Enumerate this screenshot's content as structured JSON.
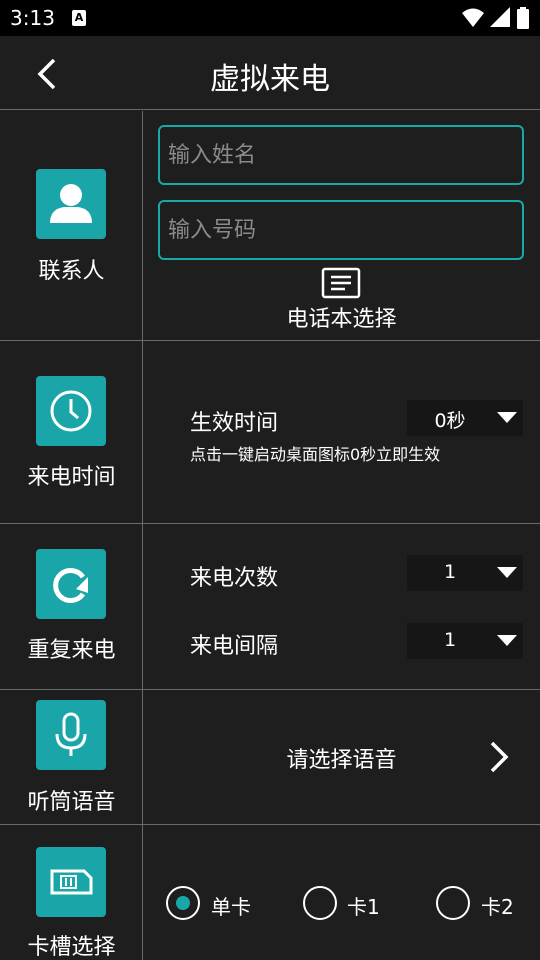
{
  "status_bar": {
    "time": "3:13",
    "a_icon": "A",
    "icons": [
      "wifi-icon",
      "signal-icon",
      "battery-icon"
    ]
  },
  "app_bar": {
    "title": "虚拟来电",
    "back_icon": "back-arrow-icon"
  },
  "contact": {
    "label": "联系人",
    "icon": "person-icon",
    "name_placeholder": "输入姓名",
    "name_value": "",
    "number_placeholder": "输入号码",
    "number_value": "",
    "phonebook_icon": "list-icon",
    "phonebook_label": "电话本选择"
  },
  "call_time": {
    "label": "来电时间",
    "icon": "clock-icon",
    "effective_label": "生效时间",
    "effective_value": "0秒",
    "hint": "点击一键启动桌面图标0秒立即生效"
  },
  "repeat": {
    "label": "重复来电",
    "icon": "repeat-icon",
    "count_label": "来电次数",
    "count_value": "1",
    "interval_label": "来电间隔",
    "interval_value": "1"
  },
  "voice": {
    "label": "听筒语音",
    "icon": "microphone-icon",
    "select_label": "请选择语音",
    "arrow_icon": "chevron-right-icon"
  },
  "sim": {
    "label": "卡槽选择",
    "icon": "sim-card-icon",
    "options": [
      {
        "label": "单卡",
        "selected": true
      },
      {
        "label": "卡1",
        "selected": false
      },
      {
        "label": "卡2",
        "selected": false
      }
    ]
  },
  "colors": {
    "accent": "#1aa6a8",
    "background": "#1e1e1e",
    "divider": "#6a6a6a"
  }
}
